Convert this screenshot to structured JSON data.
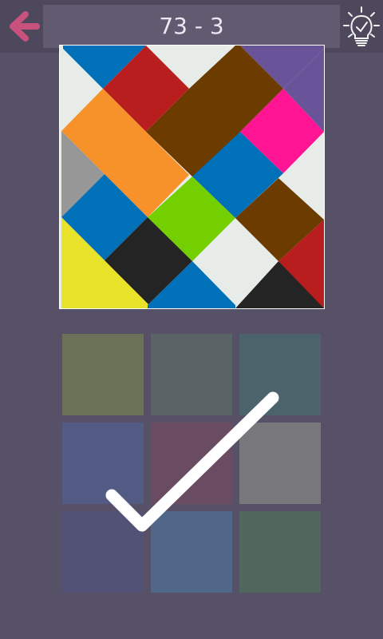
{
  "header": {
    "level_label": "73 - 3",
    "back_icon": "arrow-left-icon",
    "hint_icon": "lightbulb-check-icon",
    "back_color": "#c9517e"
  },
  "puzzle": {
    "description_colors": [
      "#0070b8",
      "#b81e1e",
      "#e8ece8",
      "#6a5499",
      "#6b3b00",
      "#f7912a",
      "#ff1493",
      "#979797",
      "#74cf00",
      "#242424",
      "#e8e32a"
    ]
  },
  "palette": {
    "swatches": [
      {
        "color": "#6b7257"
      },
      {
        "color": "#5a6366"
      },
      {
        "color": "#4c636c"
      },
      {
        "color": "#535b85"
      },
      {
        "color": "#6a4c62"
      },
      {
        "color": "#78787c"
      },
      {
        "color": "#525277"
      },
      {
        "color": "#50678a"
      },
      {
        "color": "#50675e"
      }
    ]
  },
  "overlay": {
    "icon": "checkmark-icon",
    "state": "solved"
  }
}
